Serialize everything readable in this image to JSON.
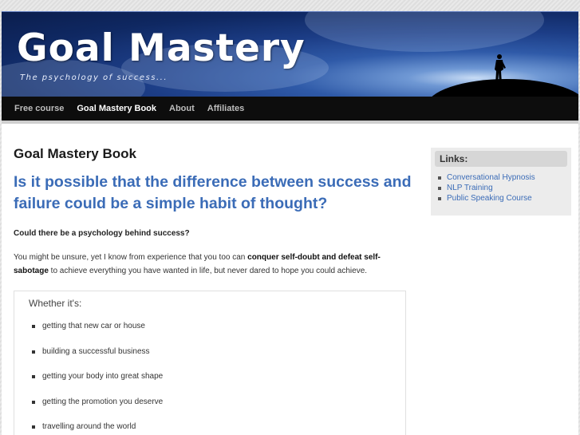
{
  "header": {
    "site_title": "Goal Mastery",
    "tagline": "The psychology of success..."
  },
  "nav": {
    "items": [
      {
        "label": "Free course",
        "active": false
      },
      {
        "label": "Goal Mastery Book",
        "active": true
      },
      {
        "label": "About",
        "active": false
      },
      {
        "label": "Affiliates",
        "active": false
      }
    ]
  },
  "main": {
    "page_heading": "Goal Mastery Book",
    "headline": "Is it possible that the difference between success and failure could be a simple habit of thought?",
    "question": "Could there be a psychology behind success?",
    "para_intro": "You might be unsure, yet I know from experience that you too can ",
    "para_bold": "conquer self-doubt and defeat self-sabotage",
    "para_rest": " to achieve everything you have wanted in life, but never dared to hope you could achieve.",
    "box": {
      "title": "Whether it's:",
      "items": [
        "getting that new car or house",
        "building a successful business",
        "getting your body into great shape",
        "getting the promotion you deserve",
        "travelling around the world"
      ]
    }
  },
  "sidebar": {
    "title": "Links:",
    "links": [
      "Conversational Hypnosis",
      "NLP Training",
      "Public Speaking Course"
    ]
  },
  "colors": {
    "link": "#3b6cb7",
    "nav_bg": "#0d0d0d",
    "banner_blue": "#1c3d86"
  }
}
